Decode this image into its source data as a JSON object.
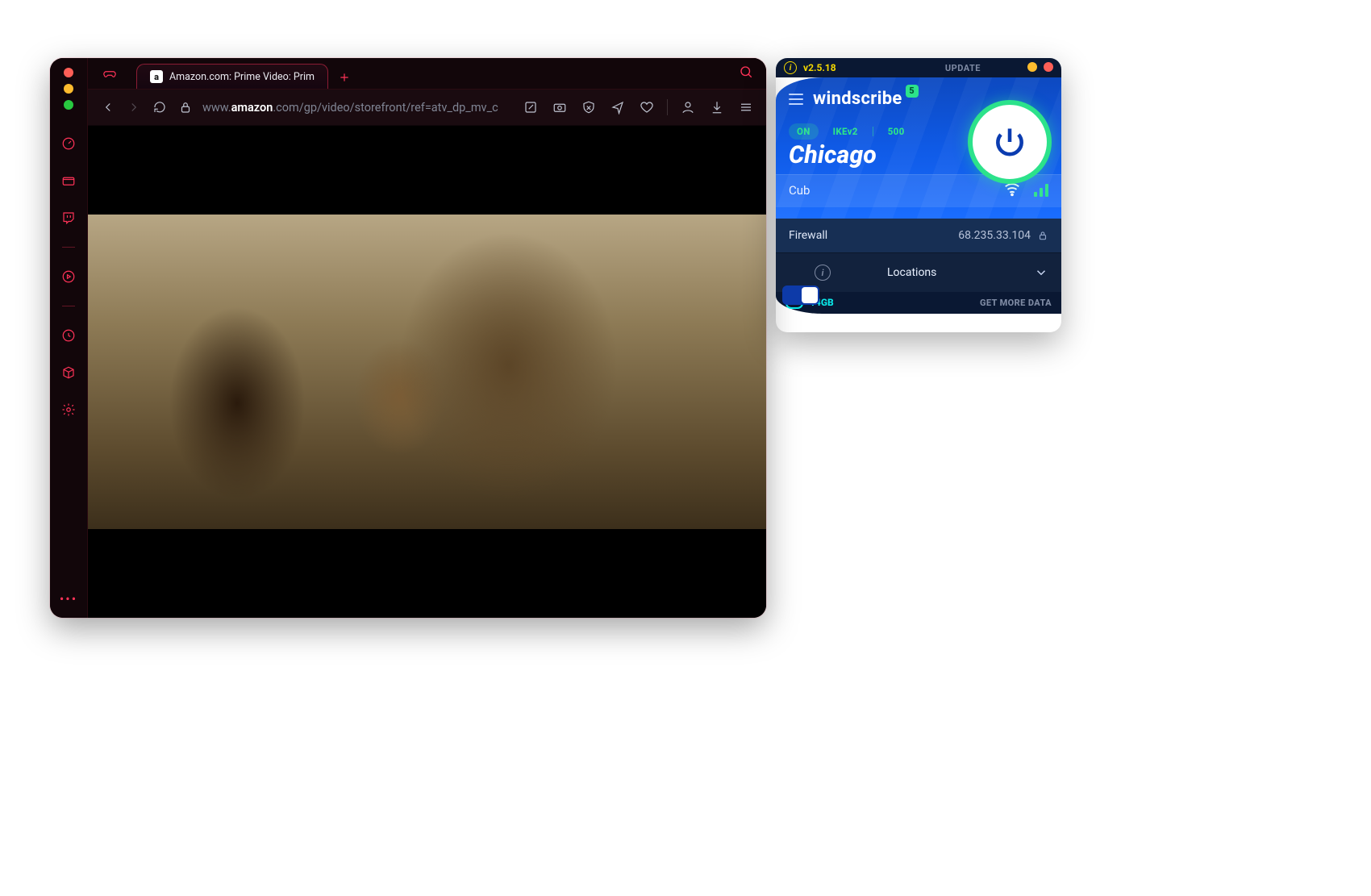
{
  "browser": {
    "tab": {
      "favicon_letter": "a",
      "title": "Amazon.com: Prime Video: Prim"
    },
    "addressbar": {
      "host_prefix": "www.",
      "host_bold": "amazon",
      "host_suffix": ".com",
      "path": "/gp/video/storefront/ref=atv_dp_mv_c"
    }
  },
  "vpn": {
    "version": "v2.5.18",
    "update_label": "UPDATE",
    "brand": "windscribe",
    "notif_count": "5",
    "status": {
      "state": "ON",
      "protocol": "IKEv2",
      "port": "500"
    },
    "city": "Chicago",
    "server": "Cub",
    "firewall_label": "Firewall",
    "ip": "68.235.33.104",
    "locations_label": "Locations",
    "data_remaining": "14GB",
    "get_more_label": "GET MORE DATA"
  }
}
